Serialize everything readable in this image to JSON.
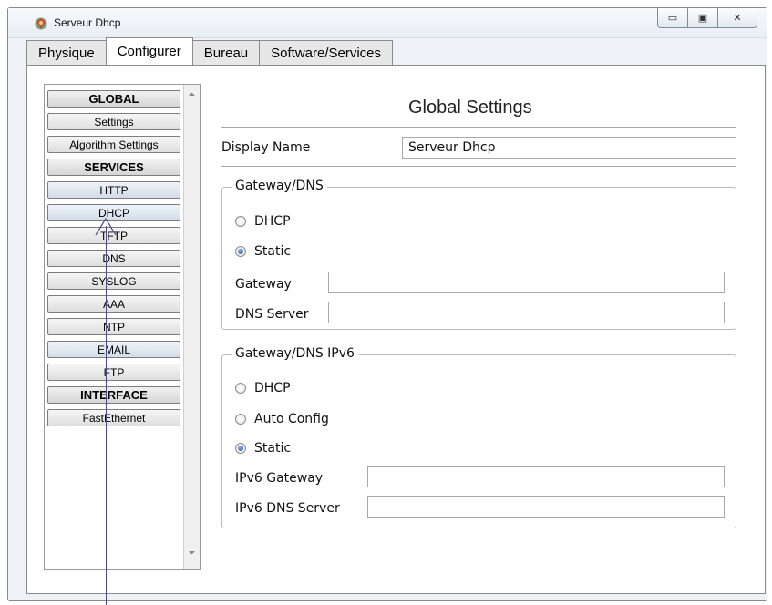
{
  "window": {
    "title": "Serveur Dhcp",
    "controls": {
      "minimize": "▭",
      "maximize": "▣",
      "close": "✕"
    }
  },
  "tabs": [
    {
      "label": "Physique",
      "active": false
    },
    {
      "label": "Configurer",
      "active": true
    },
    {
      "label": "Bureau",
      "active": false
    },
    {
      "label": "Software/Services",
      "active": false
    }
  ],
  "sidebar": {
    "items": [
      {
        "label": "GLOBAL",
        "type": "header"
      },
      {
        "label": "Settings",
        "type": "item"
      },
      {
        "label": "Algorithm Settings",
        "type": "item"
      },
      {
        "label": "SERVICES",
        "type": "header"
      },
      {
        "label": "HTTP",
        "type": "item"
      },
      {
        "label": "DHCP",
        "type": "item"
      },
      {
        "label": "TFTP",
        "type": "item"
      },
      {
        "label": "DNS",
        "type": "item"
      },
      {
        "label": "SYSLOG",
        "type": "item"
      },
      {
        "label": "AAA",
        "type": "item"
      },
      {
        "label": "NTP",
        "type": "item"
      },
      {
        "label": "EMAIL",
        "type": "item"
      },
      {
        "label": "FTP",
        "type": "item"
      },
      {
        "label": "INTERFACE",
        "type": "header"
      },
      {
        "label": "FastEthernet",
        "type": "item"
      }
    ]
  },
  "main": {
    "heading": "Global Settings",
    "display_name_label": "Display Name",
    "display_name_value": "Serveur Dhcp",
    "gateway_dns": {
      "legend": "Gateway/DNS",
      "dhcp_label": "DHCP",
      "static_label": "Static",
      "selected": "static",
      "gateway_label": "Gateway",
      "gateway_value": "",
      "dns_label": "DNS Server",
      "dns_value": ""
    },
    "gateway_dns_ipv6": {
      "legend": "Gateway/DNS IPv6",
      "dhcp_label": "DHCP",
      "auto_label": "Auto Config",
      "static_label": "Static",
      "selected": "static",
      "gateway_label": "IPv6 Gateway",
      "gateway_value": "",
      "dns_label": "IPv6 DNS Server",
      "dns_value": ""
    }
  }
}
